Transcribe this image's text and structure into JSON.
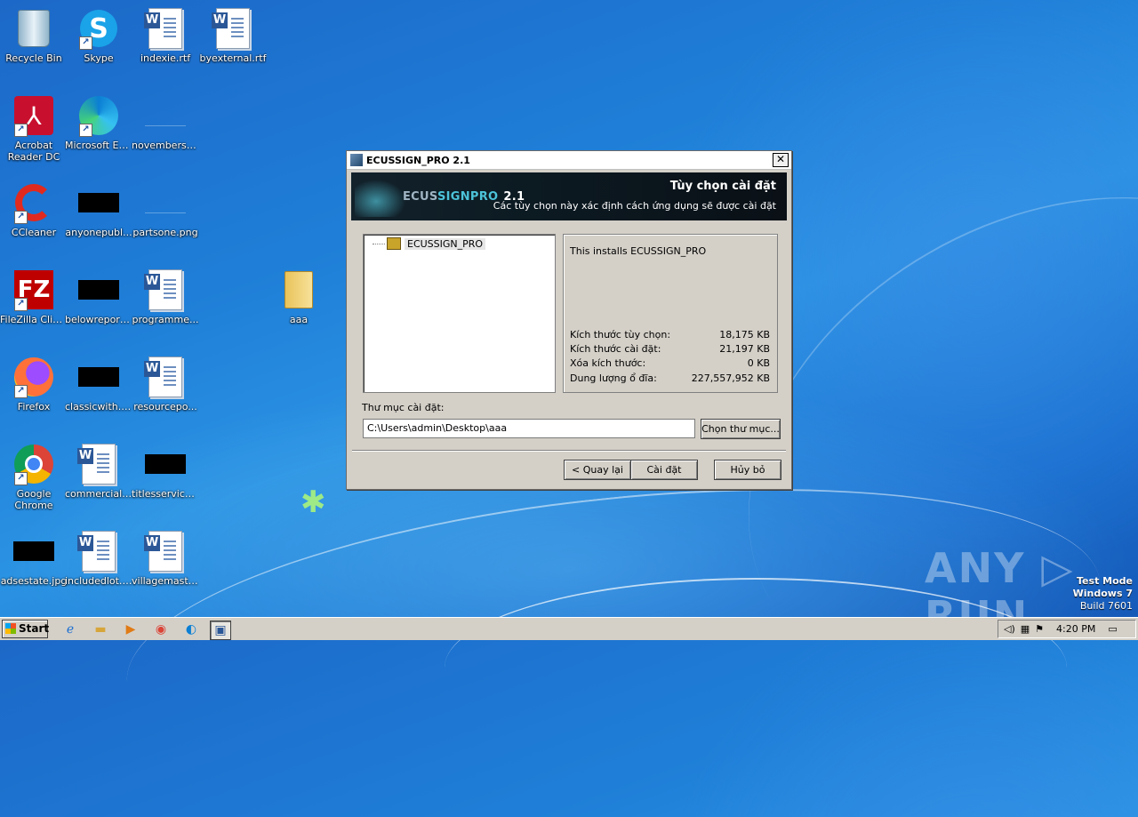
{
  "desktop": {
    "icons": [
      {
        "label": "Recycle Bin",
        "icon": "recycle-bin-icon"
      },
      {
        "label": "Skype",
        "icon": "skype-icon"
      },
      {
        "label": "indexie.rtf",
        "icon": "word-document-icon"
      },
      {
        "label": "byexternal.rtf",
        "icon": "word-document-icon"
      },
      {
        "label": "Acrobat Reader DC",
        "icon": "acrobat-icon"
      },
      {
        "label": "Microsoft Edge",
        "icon": "edge-icon"
      },
      {
        "label": "novemberso...",
        "icon": "image-file-icon"
      },
      {
        "label": "CCleaner",
        "icon": "ccleaner-icon"
      },
      {
        "label": "anyonepubl...",
        "icon": "image-file-icon"
      },
      {
        "label": "partsone.png",
        "icon": "image-file-icon"
      },
      {
        "label": "FileZilla Client",
        "icon": "filezilla-icon"
      },
      {
        "label": "belowreport...",
        "icon": "image-file-icon"
      },
      {
        "label": "programme...",
        "icon": "word-document-icon"
      },
      {
        "label": "aaa",
        "icon": "folder-icon"
      },
      {
        "label": "Firefox",
        "icon": "firefox-icon"
      },
      {
        "label": "classicwith.jpg",
        "icon": "image-file-icon"
      },
      {
        "label": "resourcepo...",
        "icon": "word-document-icon"
      },
      {
        "label": "Google Chrome",
        "icon": "chrome-icon"
      },
      {
        "label": "commerciala...",
        "icon": "word-document-icon"
      },
      {
        "label": "titlesservice...",
        "icon": "image-file-icon"
      },
      {
        "label": "adsestate.jpg",
        "icon": "image-file-icon"
      },
      {
        "label": "includedlot.rtf",
        "icon": "word-document-icon"
      },
      {
        "label": "villagemaste...",
        "icon": "word-document-icon"
      }
    ]
  },
  "dialog": {
    "title": "ECUSSIGN_PRO 2.1",
    "close_glyph": "✕",
    "banner": {
      "brand_a": "ECUS",
      "brand_b": "SIGNPRO",
      "brand_version": "2.1",
      "heading": "Tùy chọn cài đặt",
      "subheading": "Các tùy chọn này xác định cách ứng dụng sẽ được cài đặt"
    },
    "tree_item": "ECUSSIGN_PRO",
    "description": "This installs ECUSSIGN_PRO",
    "sizes": [
      {
        "label": "Kích thước tùy chọn:",
        "value": "18,175 KB"
      },
      {
        "label": "Kích thước cài đặt:",
        "value": "21,197 KB"
      },
      {
        "label": "Xóa kích thước:",
        "value": "0 KB"
      },
      {
        "label": "Dung lượng ổ đĩa:",
        "value": "227,557,952 KB"
      }
    ],
    "folder_label": "Thư mục cài đặt:",
    "folder_value": "C:\\Users\\admin\\Desktop\\aaa",
    "browse_button": "Chọn thư mục...",
    "back_button": "< Quay lại",
    "install_button": "Cài đặt",
    "cancel_button": "Hủy bỏ"
  },
  "watermark": "ANY ▷ RUN",
  "test_mode": {
    "line1": "Test Mode",
    "line2": "Windows 7",
    "line3": "Build 7601"
  },
  "taskbar": {
    "start_label": "Start",
    "pinned": [
      "internet-explorer-icon",
      "explorer-folder-icon",
      "media-player-icon",
      "chrome-icon",
      "edge-icon",
      "installer-icon"
    ],
    "clock": "4:20 PM"
  }
}
